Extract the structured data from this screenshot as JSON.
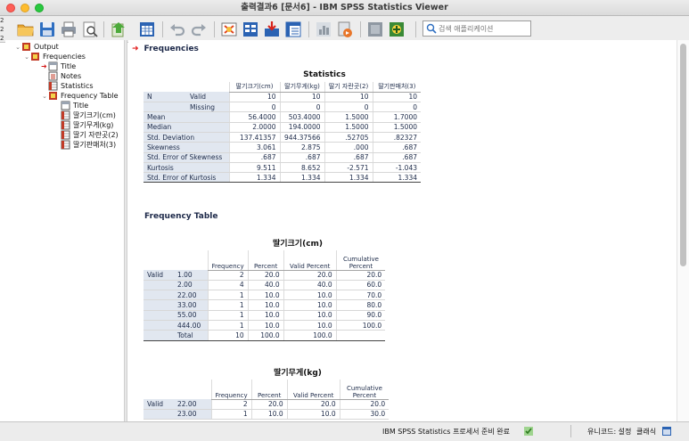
{
  "window": {
    "title": "출력결과6 [문서6] - IBM SPSS Statistics Viewer",
    "left_edge": [
      "2",
      "2",
      "2"
    ]
  },
  "toolbar": {
    "search_placeholder": "검색 애플리케이션",
    "buttons": [
      "open-icon",
      "save-icon",
      "print-icon",
      "print-preview-icon",
      "export-icon",
      "goto-data-icon",
      "undo-icon",
      "redo-icon",
      "goto-case-icon",
      "variables-icon",
      "insert-output-icon",
      "pivot-icon",
      "chart-icon",
      "script-icon",
      "designate-window-icon",
      "add-icon"
    ]
  },
  "outline": [
    {
      "label": "Output",
      "level": 0,
      "icon": "output-book-icon",
      "expander": "chevron-down",
      "current": false
    },
    {
      "label": "Frequencies",
      "level": 1,
      "icon": "procedure-book-icon",
      "expander": "chevron-down",
      "current": false
    },
    {
      "label": "Title",
      "level": 2,
      "icon": "title-icon",
      "expander": "",
      "current": true
    },
    {
      "label": "Notes",
      "level": 2,
      "icon": "notes-icon",
      "expander": "",
      "current": false
    },
    {
      "label": "Statistics",
      "level": 2,
      "icon": "table-icon",
      "expander": "",
      "current": false
    },
    {
      "label": "Frequency Table",
      "level": 2,
      "icon": "procedure-book-icon",
      "expander": "chevron-down",
      "current": false
    },
    {
      "label": "Title",
      "level": 3,
      "icon": "title-icon",
      "expander": "",
      "current": false
    },
    {
      "label": "딸기크기(cm)",
      "level": 3,
      "icon": "table-icon",
      "expander": "",
      "current": false
    },
    {
      "label": "딸기무게(kg)",
      "level": 3,
      "icon": "table-icon",
      "expander": "",
      "current": false
    },
    {
      "label": "딸기 자란곳(2)",
      "level": 3,
      "icon": "table-icon",
      "expander": "",
      "current": false
    },
    {
      "label": "딸기판매처(3)",
      "level": 3,
      "icon": "table-icon",
      "expander": "",
      "current": false
    }
  ],
  "content": {
    "frequencies_heading": "Frequencies",
    "statistics": {
      "title": "Statistics",
      "columns": [
        "딸기크기(cm)",
        "딸기무게(kg)",
        "딸기 자란곳(2)",
        "딸기판매처(3)"
      ],
      "rows": [
        {
          "label": "N",
          "sub": "Valid",
          "values": [
            "10",
            "10",
            "10",
            "10"
          ]
        },
        {
          "label": "",
          "sub": "Missing",
          "values": [
            "0",
            "0",
            "0",
            "0"
          ]
        },
        {
          "label": "Mean",
          "sub": "",
          "values": [
            "56.4000",
            "503.4000",
            "1.5000",
            "1.7000"
          ]
        },
        {
          "label": "Median",
          "sub": "",
          "values": [
            "2.0000",
            "194.0000",
            "1.5000",
            "1.5000"
          ]
        },
        {
          "label": "Std. Deviation",
          "sub": "",
          "values": [
            "137.41357",
            "944.37566",
            ".52705",
            ".82327"
          ]
        },
        {
          "label": "Skewness",
          "sub": "",
          "values": [
            "3.061",
            "2.875",
            ".000",
            ".687"
          ]
        },
        {
          "label": "Std. Error of Skewness",
          "sub": "",
          "values": [
            ".687",
            ".687",
            ".687",
            ".687"
          ]
        },
        {
          "label": "Kurtosis",
          "sub": "",
          "values": [
            "9.511",
            "8.652",
            "-2.571",
            "-1.043"
          ]
        },
        {
          "label": "Std. Error of Kurtosis",
          "sub": "",
          "values": [
            "1.334",
            "1.334",
            "1.334",
            "1.334"
          ]
        }
      ]
    },
    "frequency_table_heading": "Frequency Table",
    "freq_columns": [
      "Frequency",
      "Percent",
      "Valid Percent",
      "Cumulative Percent"
    ],
    "size_table": {
      "title": "딸기크기(cm)",
      "group": "Valid",
      "rows": [
        {
          "value": "1.00",
          "cells": [
            "2",
            "20.0",
            "20.0",
            "20.0"
          ]
        },
        {
          "value": "2.00",
          "cells": [
            "4",
            "40.0",
            "40.0",
            "60.0"
          ]
        },
        {
          "value": "22.00",
          "cells": [
            "1",
            "10.0",
            "10.0",
            "70.0"
          ]
        },
        {
          "value": "33.00",
          "cells": [
            "1",
            "10.0",
            "10.0",
            "80.0"
          ]
        },
        {
          "value": "55.00",
          "cells": [
            "1",
            "10.0",
            "10.0",
            "90.0"
          ]
        },
        {
          "value": "444.00",
          "cells": [
            "1",
            "10.0",
            "10.0",
            "100.0"
          ]
        },
        {
          "value": "Total",
          "cells": [
            "10",
            "100.0",
            "100.0",
            ""
          ]
        }
      ]
    },
    "weight_table": {
      "title": "딸기무게(kg)",
      "group": "Valid",
      "rows": [
        {
          "value": "22.00",
          "cells": [
            "2",
            "20.0",
            "20.0",
            "20.0"
          ]
        },
        {
          "value": "23.00",
          "cells": [
            "1",
            "10.0",
            "10.0",
            "30.0"
          ]
        }
      ]
    }
  },
  "status": {
    "main": "IBM SPSS Statistics 프로세서 준비 완료",
    "unicode": "유니코드: 설정",
    "classic": "클래식"
  },
  "colors": {
    "label_cell_bg": "#e1e7f0",
    "heading_arrow": "#e21b1b",
    "table_text": "#1d2b49"
  }
}
